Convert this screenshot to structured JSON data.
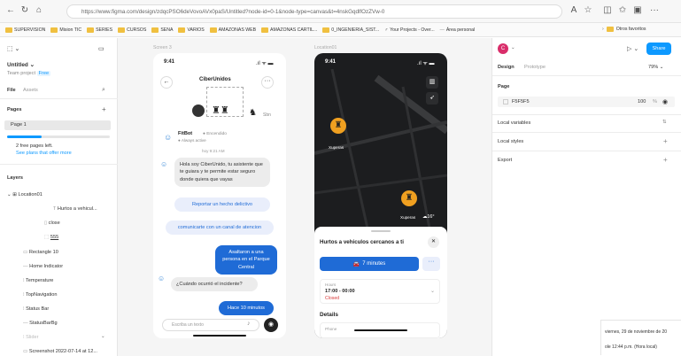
{
  "browser": {
    "url": "https://www.figma.com/design/zdqcPSO6deVovoAVx0paS/Untitled?node-id=0-1&node-type=canvas&t=4nskGqdlfOzZVw-0",
    "bookmarks": [
      "SUPERVISION",
      "Mision TIC",
      "SERIES",
      "CURSOS",
      "SENA",
      "VARIOS",
      "AMAZONAS WEB",
      "AMAZONAS CARTIL...",
      "0_INGENIERIA_SIST...",
      "Your Projects - Over...",
      "Área personal"
    ],
    "other_favorites": "Otros favoritos"
  },
  "left_panel": {
    "file_title": "Untitled",
    "team": "Team project",
    "plan_badge": "Free",
    "tabs": [
      "File",
      "Assets"
    ],
    "pages_label": "Pages",
    "page1": "Page 1",
    "free_pages_note": "2 free pages left.",
    "see_plans": "See plans that offer more",
    "layers_label": "Layers",
    "layers": [
      "Location01",
      "Hurtos a vehicul...",
      "close",
      "555",
      "Rectangle 10",
      "Home Indicator",
      "Temperature",
      "TopNavigation",
      "Status Bar",
      "StatusBarBg",
      "Slider",
      "Screenshot 2022-07-14 at 12..."
    ]
  },
  "canvas": {
    "frame1_label": "Screen 3",
    "frame2_label": "Location01",
    "chat": {
      "time": "9:41",
      "app_name": "CiberUnidos",
      "bot_name": "FitBot",
      "bot_status": "Encendido",
      "bot_sub": "Always active",
      "ts": "hoy 9:21 AM",
      "avatar_label": "Sbn",
      "msg1": "Hola soy CiberUnido, tu asistente que te guiara y te permite estar seguro donde quiera que vayas",
      "opt1": "Reportar un hecho delictivo",
      "opt2": "comunicarte con un canal de atencion",
      "user1": "Asaltaron a una persona en el Parque Central",
      "bot_q": "¿Cuándo ocurrió el incidente?",
      "user2": "Hace 10 minutos",
      "input_placeholder": "Escriba un texto"
    },
    "map": {
      "time": "9:41",
      "marker_labels": [
        "Xuperas",
        "Xuperas"
      ],
      "temp": "16°",
      "sheet_title": "Hurtos a vehiculos cercanos a ti",
      "route_time": "7 minutes",
      "hours_label": "Hours",
      "hours": "17:00 - 00:00",
      "closed": "Closed",
      "details": "Details",
      "phone_label": "Phone"
    }
  },
  "right_panel": {
    "user_initial": "C",
    "share": "Share",
    "tabs": [
      "Design",
      "Prototype"
    ],
    "zoom": "79%",
    "page_section": "Page",
    "bg_color": "F5F5F5",
    "bg_opacity": "100",
    "pct": "%",
    "local_variables": "Local variables",
    "local_styles": "Local styles",
    "export": "Export"
  },
  "taskbar": {
    "date": "viernes, 29 de noviembre de 20",
    "time": "ole 12:44 p.m. (Hora local)"
  },
  "colors": {
    "accent": "#0d99ff",
    "blue_bubble": "#1f6bd6",
    "route_btn": "#1f6bd6",
    "map_bg": "#1c1d1f",
    "closed": "#d93b3b"
  }
}
